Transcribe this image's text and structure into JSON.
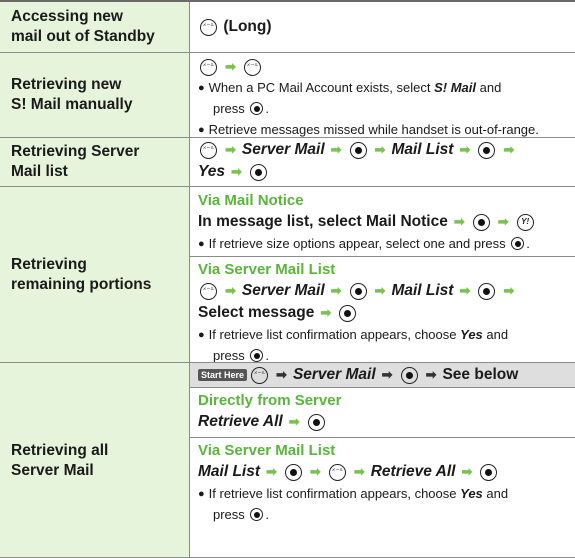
{
  "colors": {
    "label_bg": "#e7f4dc",
    "accent_green": "#59b63a",
    "arrow": "#79c24f",
    "rule": "#8c8c8c",
    "start_here_bg": "#dedede"
  },
  "rows": {
    "r1": {
      "label": [
        "Accessing new",
        "mail out of Standby"
      ],
      "keys": "(Long)"
    },
    "r2": {
      "label": [
        "Retrieving new",
        "S! Mail manually"
      ],
      "b1_a": "When a PC Mail Account exists, select",
      "b1_b": "S! Mail",
      "b1_c": "and",
      "b1_d": "press",
      "b2": "Retrieve messages missed while handset is out-of-range."
    },
    "r3": {
      "label": [
        "Retrieving Server",
        "Mail list"
      ],
      "server_mail": "Server Mail",
      "mail_list": "Mail List",
      "yes": "Yes"
    },
    "r4": {
      "label": [
        "Retrieving",
        "remaining portions"
      ],
      "s1_title": "Via Mail Notice",
      "s1_line": "In message list, select Mail Notice",
      "s1_bullet": "If retrieve size options appear, select one and press",
      "s2_title": "Via Server Mail List",
      "server_mail": "Server Mail",
      "mail_list": "Mail List",
      "select_message": "Select message",
      "b_a": "If retrieve list confirmation appears, choose",
      "b_yes": "Yes",
      "b_and": "and",
      "b_press": "press"
    },
    "r5": {
      "label": [
        "Retrieving all",
        "Server Mail"
      ],
      "start_here": "Start Here",
      "server_mail": "Server Mail",
      "see_below": "See below",
      "s1_title": "Directly from Server",
      "retrieve_all": "Retrieve All",
      "s2_title": "Via Server Mail List",
      "mail_list": "Mail List",
      "b_a": "If retrieve list confirmation appears, choose",
      "b_yes": "Yes",
      "b_and": "and",
      "b_press": "press"
    }
  }
}
